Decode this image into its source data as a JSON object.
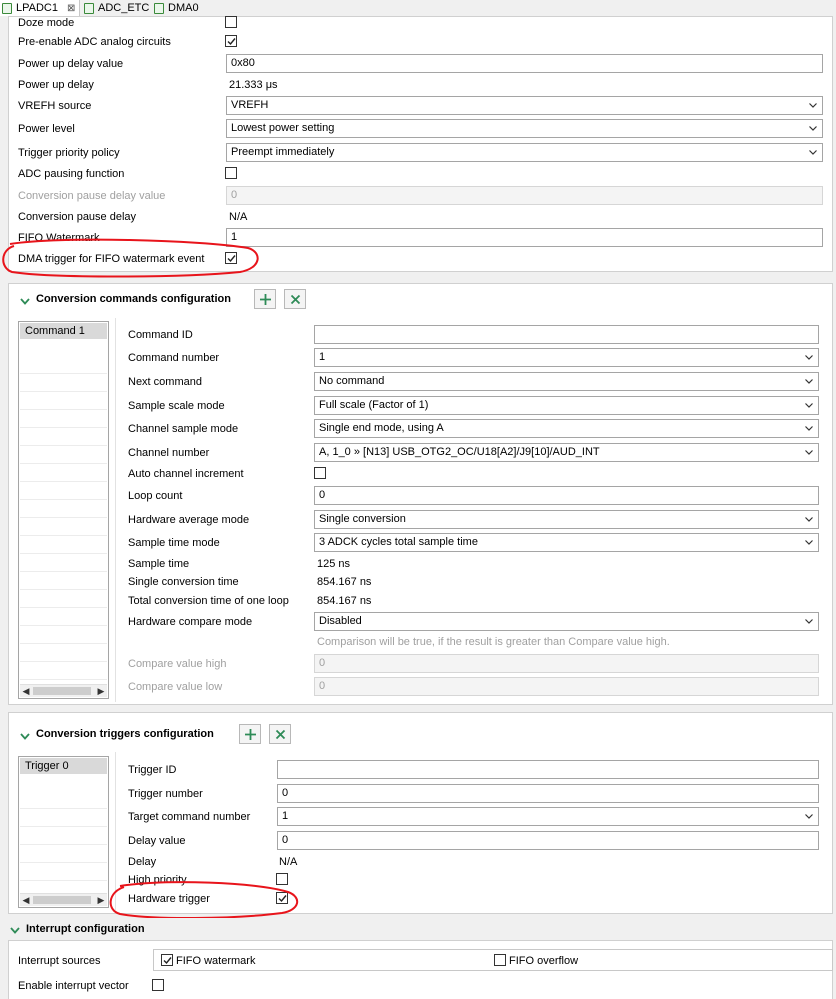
{
  "tabs": [
    {
      "label": "LPADC1",
      "close": "⊠"
    },
    {
      "label": "ADC_ETC"
    },
    {
      "label": "DMA0"
    }
  ],
  "general": {
    "rows": [
      {
        "label": "Doze mode",
        "type": "checkbox",
        "checked": false
      },
      {
        "label": "Pre-enable ADC analog circuits",
        "type": "checkbox",
        "checked": true
      },
      {
        "label": "Power up delay value",
        "type": "input",
        "value": "0x80"
      },
      {
        "label": "Power up delay",
        "type": "text",
        "value": "21.333 μs"
      },
      {
        "label": "VREFH source",
        "type": "select",
        "value": "VREFH"
      },
      {
        "label": "Power level",
        "type": "select",
        "value": "Lowest power setting"
      },
      {
        "label": "Trigger priority policy",
        "type": "select",
        "value": "Preempt immediately"
      },
      {
        "label": "ADC pausing function",
        "type": "checkbox",
        "checked": false
      },
      {
        "label": "Conversion pause delay value",
        "type": "input",
        "value": "0",
        "disabled": true
      },
      {
        "label": "Conversion pause delay",
        "type": "text",
        "value": "N/A"
      },
      {
        "label": "FIFO Watermark",
        "type": "input",
        "value": "1"
      },
      {
        "label": "DMA trigger for FIFO watermark event",
        "type": "checkbox",
        "checked": true
      }
    ]
  },
  "commands": {
    "title": "Conversion commands configuration",
    "list": [
      "Command 1"
    ],
    "rows": [
      {
        "label": "Command ID",
        "type": "input",
        "value": ""
      },
      {
        "label": "Command number",
        "type": "select",
        "value": "1"
      },
      {
        "label": "Next command",
        "type": "select",
        "value": "No command"
      },
      {
        "label": "Sample scale mode",
        "type": "select",
        "value": "Full scale (Factor of 1)"
      },
      {
        "label": "Channel sample mode",
        "type": "select",
        "value": "Single end mode, using A"
      },
      {
        "label": "Channel number",
        "type": "select",
        "value": "A, 1_0 » [N13] USB_OTG2_OC/U18[A2]/J9[10]/AUD_INT"
      },
      {
        "label": "Auto channel increment",
        "type": "checkbox",
        "checked": false
      },
      {
        "label": "Loop count",
        "type": "input",
        "value": "0"
      },
      {
        "label": "Hardware average mode",
        "type": "select",
        "value": "Single conversion"
      },
      {
        "label": "Sample time mode",
        "type": "select",
        "value": "3 ADCK cycles total sample time"
      },
      {
        "label": "Sample time",
        "type": "text",
        "value": "125 ns"
      },
      {
        "label": "Single conversion time",
        "type": "text",
        "value": "854.167 ns"
      },
      {
        "label": "Total conversion time of one loop",
        "type": "text",
        "value": "854.167 ns"
      },
      {
        "label": "Hardware compare mode",
        "type": "select",
        "value": "Disabled"
      },
      {
        "label": "",
        "type": "note",
        "value": "Comparison will be true, if the result is greater than Compare value high."
      },
      {
        "label": "Compare value high",
        "type": "input",
        "value": "0",
        "disabled": true
      },
      {
        "label": "Compare value low",
        "type": "input",
        "value": "0",
        "disabled": true
      }
    ]
  },
  "triggers": {
    "title": "Conversion triggers configuration",
    "list": [
      "Trigger 0"
    ],
    "rows": [
      {
        "label": "Trigger ID",
        "type": "input",
        "value": ""
      },
      {
        "label": "Trigger number",
        "type": "input",
        "value": "0"
      },
      {
        "label": "Target command number",
        "type": "select",
        "value": "1"
      },
      {
        "label": "Delay value",
        "type": "input",
        "value": "0"
      },
      {
        "label": "Delay",
        "type": "text",
        "value": "N/A"
      },
      {
        "label": "High priority",
        "type": "checkbox",
        "checked": false
      },
      {
        "label": "Hardware trigger",
        "type": "checkbox",
        "checked": true
      }
    ]
  },
  "interrupt": {
    "title": "Interrupt configuration",
    "sources_label": "Interrupt sources",
    "fifo_watermark": {
      "label": "FIFO watermark",
      "checked": true
    },
    "fifo_overflow": {
      "label": "FIFO overflow",
      "checked": false
    },
    "enable_vector_label": "Enable interrupt vector",
    "enable_vector_checked": false
  },
  "colors": {
    "accent_green": "#2e8b57",
    "annotation_red": "#e8141b"
  }
}
